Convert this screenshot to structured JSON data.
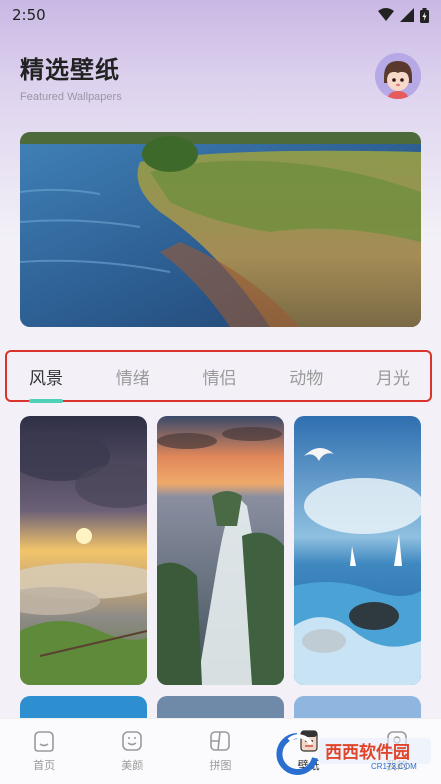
{
  "status_bar": {
    "time": "2:50",
    "icons": [
      "wifi-icon",
      "signal-icon",
      "battery-icon"
    ]
  },
  "header": {
    "title": "精选壁纸",
    "subtitle": "Featured Wallpapers"
  },
  "tabs": [
    {
      "label": "风景",
      "active": true
    },
    {
      "label": "情绪",
      "active": false
    },
    {
      "label": "情侣",
      "active": false
    },
    {
      "label": "动物",
      "active": false
    },
    {
      "label": "月光",
      "active": false
    }
  ],
  "bottom_nav": [
    {
      "label": "首页",
      "icon": "home-icon"
    },
    {
      "label": "美颜",
      "icon": "beauty-icon"
    },
    {
      "label": "拼图",
      "icon": "collage-icon"
    },
    {
      "label": "壁纸",
      "icon": "wallpaper-icon"
    },
    {
      "label": "我的",
      "icon": "profile-icon"
    }
  ],
  "colors": {
    "accent": "#4fd1b7",
    "highlight_border": "#d9332b",
    "header_gradient": "#c9b8e4"
  },
  "watermark": {
    "text": "西西软件园",
    "sub": "CR173.COM"
  }
}
